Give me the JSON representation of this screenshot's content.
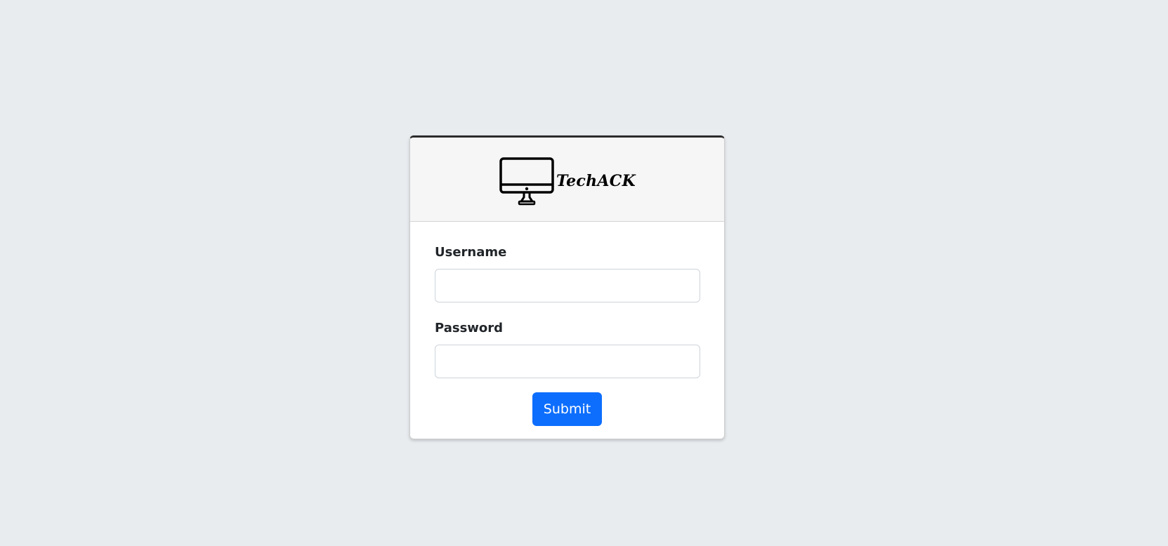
{
  "brand": {
    "name": "TechACK",
    "icon": "desktop-monitor-icon"
  },
  "form": {
    "username_label": "Username",
    "username_value": "",
    "password_label": "Password",
    "password_value": "",
    "submit_label": "Submit"
  },
  "colors": {
    "background": "#e8ecef",
    "accent": "#0d6efd",
    "card_top_border": "#2b2b2b"
  }
}
